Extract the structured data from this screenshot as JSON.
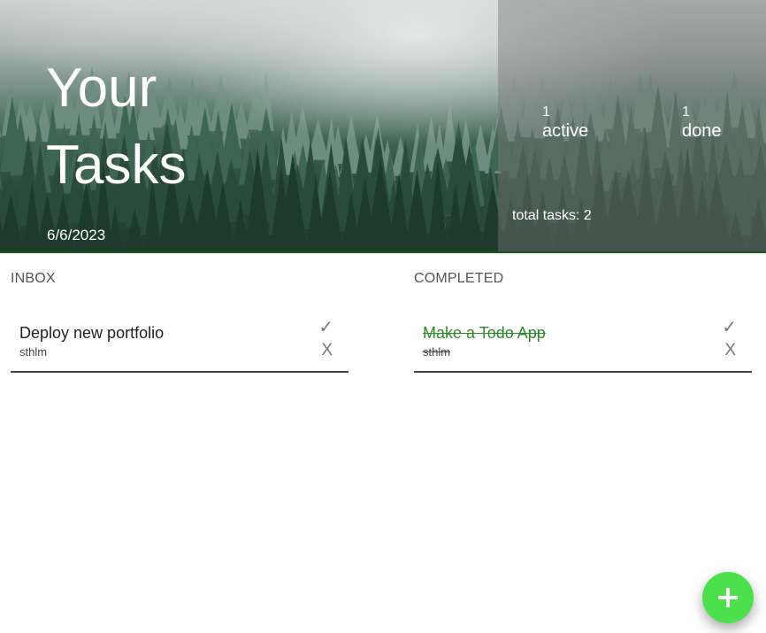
{
  "header": {
    "title_line1": "Your",
    "title_line2": "Tasks",
    "date": "6/6/2023"
  },
  "stats": {
    "active_count": "1",
    "active_label": "active",
    "done_count": "1",
    "done_label": "done",
    "total_text": "total tasks: 2"
  },
  "inbox": {
    "heading": "INBOX",
    "tasks": [
      {
        "title": "Deploy new portfolio",
        "location": "sthlm",
        "check": "✓",
        "delete": "X"
      }
    ]
  },
  "completed": {
    "heading": "COMPLETED",
    "tasks": [
      {
        "title": "Make a Todo App",
        "location": "sthlm",
        "check": "✓",
        "delete": "X"
      }
    ]
  },
  "fab": {
    "icon": "plus-icon"
  },
  "colors": {
    "accent": "#4ce14c",
    "done_text": "#2c8a2c"
  }
}
